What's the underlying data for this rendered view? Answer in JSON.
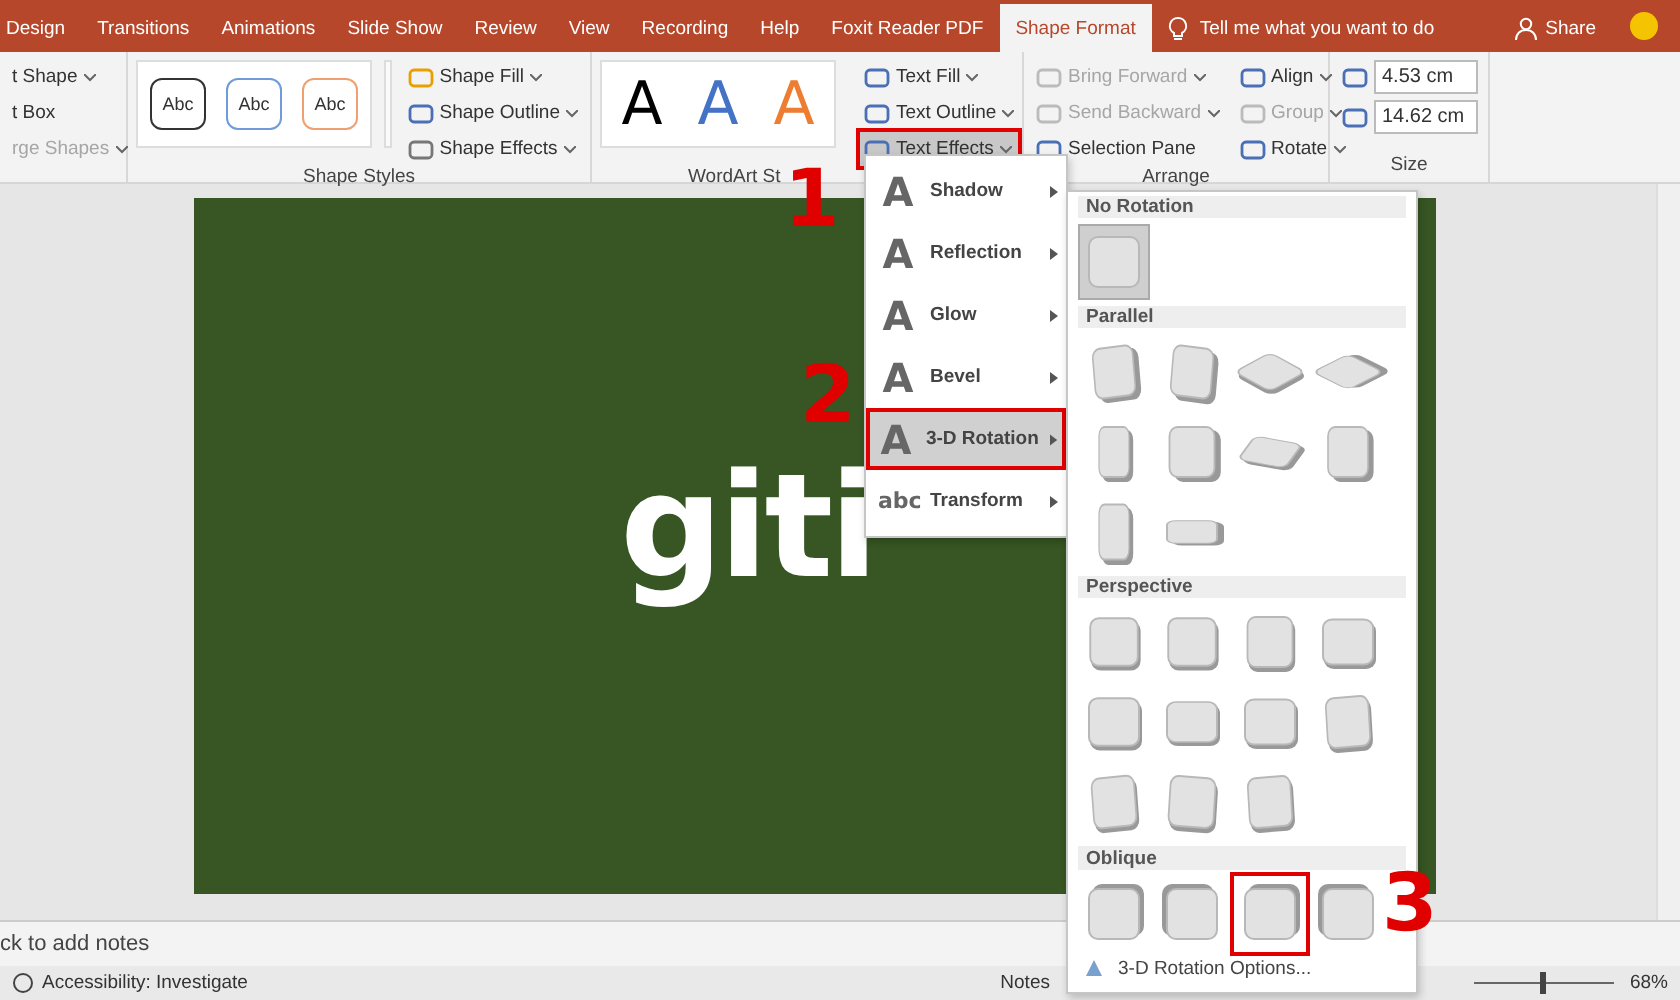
{
  "tabs": [
    {
      "label": "Design",
      "selected": false
    },
    {
      "label": "Transitions",
      "selected": false
    },
    {
      "label": "Animations",
      "selected": false
    },
    {
      "label": "Slide Show",
      "selected": false
    },
    {
      "label": "Review",
      "selected": false
    },
    {
      "label": "View",
      "selected": false
    },
    {
      "label": "Recording",
      "selected": false
    },
    {
      "label": "Help",
      "selected": false
    },
    {
      "label": "Foxit Reader PDF",
      "selected": false
    },
    {
      "label": "Shape Format",
      "selected": true
    }
  ],
  "tell_me": "Tell me what you want to do",
  "share": "Share",
  "insert_shapes": [
    {
      "label": "t Shape",
      "disabled": false,
      "dropdown": true
    },
    {
      "label": "t Box",
      "disabled": false,
      "dropdown": false
    },
    {
      "label": "rge Shapes",
      "disabled": true,
      "dropdown": true
    }
  ],
  "shape_styles": {
    "label": "Shape Styles",
    "presets": [
      {
        "text": "Abc",
        "color": "#333333"
      },
      {
        "text": "Abc",
        "color": "#6f9bd8"
      },
      {
        "text": "Abc",
        "color": "#f0a070"
      }
    ],
    "commands": [
      {
        "label": "Shape Fill"
      },
      {
        "label": "Shape Outline"
      },
      {
        "label": "Shape Effects"
      }
    ]
  },
  "wordart": {
    "label": "WordArt St",
    "letters": [
      {
        "text": "A",
        "color": "#000000"
      },
      {
        "text": "A",
        "color": "#4472c4"
      },
      {
        "text": "A",
        "color": "#ed7d31"
      }
    ],
    "commands": [
      {
        "label": "Text Fill",
        "marked": false
      },
      {
        "label": "Text Outline",
        "marked": false
      },
      {
        "label": "Text Effects",
        "marked": true
      }
    ]
  },
  "arrange": {
    "label": "Arrange",
    "commands": [
      {
        "label": "Bring Forward",
        "disabled": true
      },
      {
        "label": "Send Backward",
        "disabled": true
      },
      {
        "label": "Selection Pane",
        "disabled": false
      },
      {
        "label": "Align",
        "disabled": false
      },
      {
        "label": "Group",
        "disabled": true
      },
      {
        "label": "Rotate",
        "disabled": false
      }
    ]
  },
  "size": {
    "label": "Size",
    "fields": [
      {
        "value": "4.53 cm"
      },
      {
        "value": "14.62 cm"
      }
    ]
  },
  "slide": {
    "text": "giti"
  },
  "text_effects_menu": [
    {
      "icon": "A",
      "label": "Shadow",
      "selected": false
    },
    {
      "icon": "A",
      "label": "Reflection",
      "selected": false
    },
    {
      "icon": "A",
      "label": "Glow",
      "selected": false
    },
    {
      "icon": "A",
      "label": "Bevel",
      "selected": false
    },
    {
      "icon": "A",
      "label": "3-D Rotation",
      "selected": true
    },
    {
      "icon": "abc",
      "label": "Transform",
      "selected": false
    }
  ],
  "rotation_menu": {
    "sections": [
      {
        "title": "No Rotation",
        "presets": [
          {
            "selected": true,
            "marked": false
          }
        ]
      },
      {
        "title": "Parallel",
        "presets": [
          {
            "selected": false,
            "marked": false
          },
          {
            "selected": false,
            "marked": false
          },
          {
            "selected": false,
            "marked": false
          },
          {
            "selected": false,
            "marked": false
          },
          {
            "selected": false,
            "marked": false
          },
          {
            "selected": false,
            "marked": false
          },
          {
            "selected": false,
            "marked": false
          },
          {
            "selected": false,
            "marked": false
          },
          {
            "selected": false,
            "marked": false
          },
          {
            "selected": false,
            "marked": false
          }
        ]
      },
      {
        "title": "Perspective",
        "presets": [
          {
            "selected": false,
            "marked": false
          },
          {
            "selected": false,
            "marked": false
          },
          {
            "selected": false,
            "marked": false
          },
          {
            "selected": false,
            "marked": false
          },
          {
            "selected": false,
            "marked": false
          },
          {
            "selected": false,
            "marked": false
          },
          {
            "selected": false,
            "marked": false
          },
          {
            "selected": false,
            "marked": false
          },
          {
            "selected": false,
            "marked": false
          },
          {
            "selected": false,
            "marked": false
          },
          {
            "selected": false,
            "marked": false
          }
        ]
      },
      {
        "title": "Oblique",
        "presets": [
          {
            "selected": false,
            "marked": false
          },
          {
            "selected": false,
            "marked": false
          },
          {
            "selected": false,
            "marked": true
          },
          {
            "selected": false,
            "marked": false
          }
        ]
      }
    ],
    "footer": "3-D Rotation Options..."
  },
  "annotations": [
    {
      "label": "1"
    },
    {
      "label": "2"
    },
    {
      "label": "3"
    }
  ],
  "notes": "ck to add notes",
  "status_bar": {
    "accessibility": "Accessibility: Investigate",
    "notes": "Notes",
    "zoom": {
      "level": 0.5,
      "reading": "68%"
    }
  }
}
